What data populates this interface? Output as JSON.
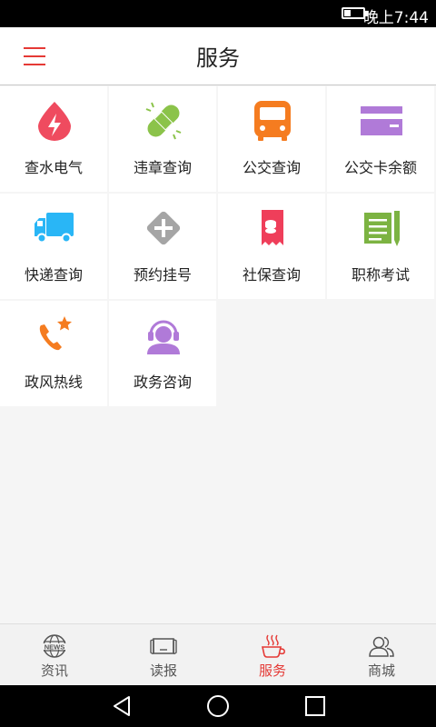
{
  "status_bar": {
    "time": "晚上7:44"
  },
  "header": {
    "title": "服务",
    "menu_icon": "menu-icon"
  },
  "services": [
    {
      "label": "查水电气",
      "icon": "drop-bolt-icon",
      "color": "#ef4b5f"
    },
    {
      "label": "违章查询",
      "icon": "bandage-icon",
      "color": "#8bc34a"
    },
    {
      "label": "公交查询",
      "icon": "bus-icon",
      "color": "#f57c20"
    },
    {
      "label": "公交卡余额",
      "icon": "card-icon",
      "color": "#b07ad8"
    },
    {
      "label": "快递查询",
      "icon": "truck-icon",
      "color": "#29b6f6"
    },
    {
      "label": "预约挂号",
      "icon": "medical-cross-icon",
      "color": "#a5a5a5"
    },
    {
      "label": "社保查询",
      "icon": "social-security-icon",
      "color": "#ef3e5a"
    },
    {
      "label": "职称考试",
      "icon": "notebook-pen-icon",
      "color": "#7cb342"
    },
    {
      "label": "政风热线",
      "icon": "phone-star-icon",
      "color": "#f57c20"
    },
    {
      "label": "政务咨询",
      "icon": "headset-person-icon",
      "color": "#b07ad8"
    }
  ],
  "tabs": [
    {
      "label": "资讯",
      "icon": "news-globe-icon",
      "active": false
    },
    {
      "label": "读报",
      "icon": "newspaper-icon",
      "active": false
    },
    {
      "label": "服务",
      "icon": "coffee-cup-icon",
      "active": true
    },
    {
      "label": "商城",
      "icon": "people-icon",
      "active": false
    }
  ],
  "colors": {
    "accent": "#e53935"
  }
}
